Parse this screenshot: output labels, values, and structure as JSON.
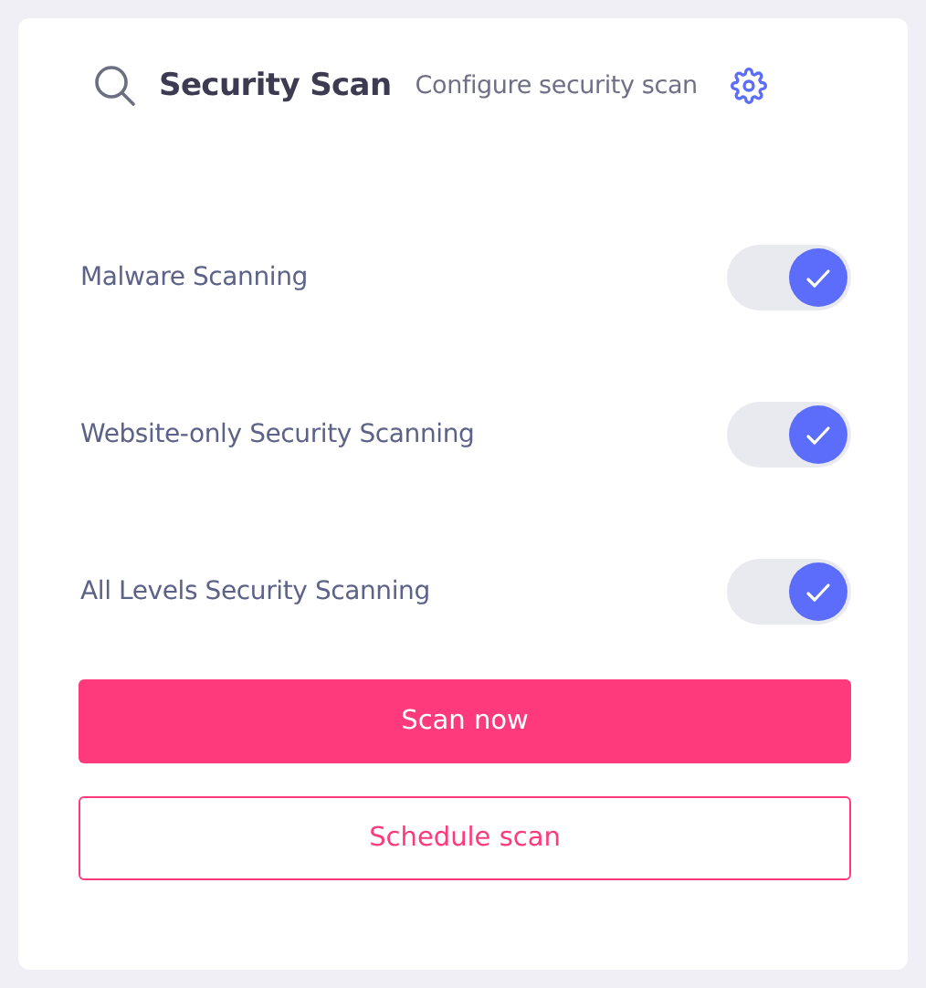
{
  "header": {
    "title": "Security Scan",
    "subtitle": "Configure security scan"
  },
  "options": [
    {
      "label": "Malware Scanning",
      "on": true
    },
    {
      "label": "Website-only Security Scanning",
      "on": true
    },
    {
      "label": "All Levels Security Scanning",
      "on": true
    }
  ],
  "buttons": [
    {
      "label": "Scan now",
      "kind": "primary"
    },
    {
      "label": "Schedule scan",
      "kind": "outline"
    }
  ]
}
